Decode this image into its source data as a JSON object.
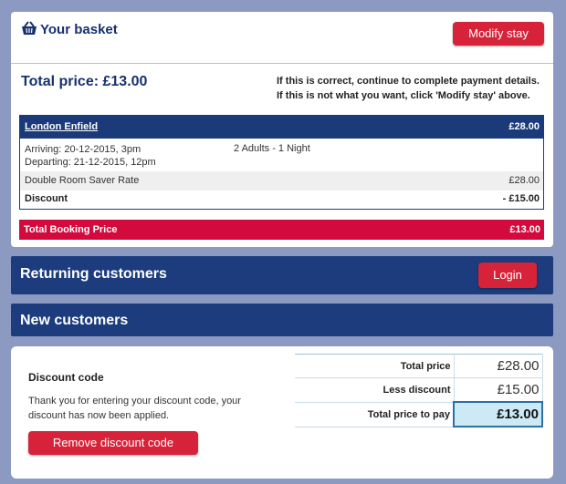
{
  "basket": {
    "title": "Your basket",
    "modify_label": "Modify stay",
    "total_heading": "Total price: £13.00",
    "note_line1": "If this is correct, continue to complete payment details.",
    "note_line2": "If this is not what you want, click 'Modify stay' above."
  },
  "booking": {
    "hotel": "London Enfield",
    "hotel_price": "£28.00",
    "arriving": "Arriving: 20-12-2015, 3pm",
    "departing": "Departing: 21-12-2015, 12pm",
    "guests": "2 Adults - 1 Night",
    "rate_label": "Double Room Saver Rate",
    "rate_price": "£28.00",
    "discount_label": "Discount",
    "discount_value": "- £15.00",
    "total_label": "Total Booking Price",
    "total_value": "£13.00"
  },
  "returning": {
    "title": "Returning customers",
    "login_label": "Login"
  },
  "new_customers": {
    "title": "New customers"
  },
  "discount": {
    "title": "Discount code",
    "message": "Thank you for entering your discount code, your discount has now been applied.",
    "remove_label": "Remove discount code"
  },
  "summary": {
    "rows": [
      {
        "label": "Total price",
        "value": "£28.00"
      },
      {
        "label": "Less discount",
        "value": "£15.00"
      },
      {
        "label": "Total price to pay",
        "value": "£13.00"
      }
    ]
  },
  "colors": {
    "navy": "#1c3c7e",
    "red": "#d20a3e",
    "button_red": "#d6233a",
    "pay_highlight": "#cde9f6"
  }
}
